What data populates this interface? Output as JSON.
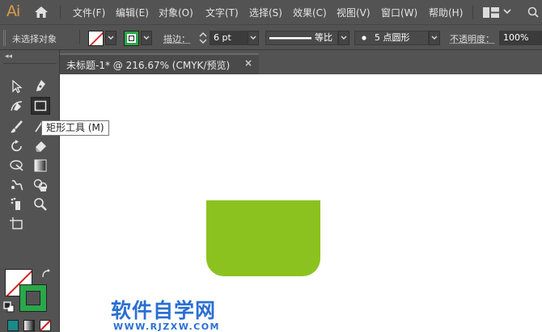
{
  "app": {
    "logo": "Ai"
  },
  "menu": {
    "items": [
      "文件(F)",
      "编辑(E)",
      "对象(O)",
      "文字(T)",
      "选择(S)",
      "效果(C)",
      "视图(V)",
      "窗口(W)",
      "帮助(H)"
    ]
  },
  "control_bar": {
    "selection_status": "未选择对象",
    "stroke_label": "描边：",
    "stroke_weight": "6 pt",
    "profile_label": "等比",
    "brush_label": "5 点圆形",
    "opacity_label": "不透明度：",
    "opacity_value": "100%"
  },
  "document": {
    "tab_title": "未标题-1* @ 216.67% (CMYK/预览)",
    "close_glyph": "×"
  },
  "tooltip": {
    "text": "矩形工具 (M)"
  },
  "toolbar": {
    "grip": "◂◂"
  },
  "artwork": {
    "shape_color": "#8cc21f"
  },
  "watermark": {
    "title": "软件自学网",
    "url": "WWW.RJZXW.COM"
  },
  "colors": {
    "accent": "#dc9a49",
    "stroke_green": "#29a84a",
    "none_red": "#d62020"
  }
}
